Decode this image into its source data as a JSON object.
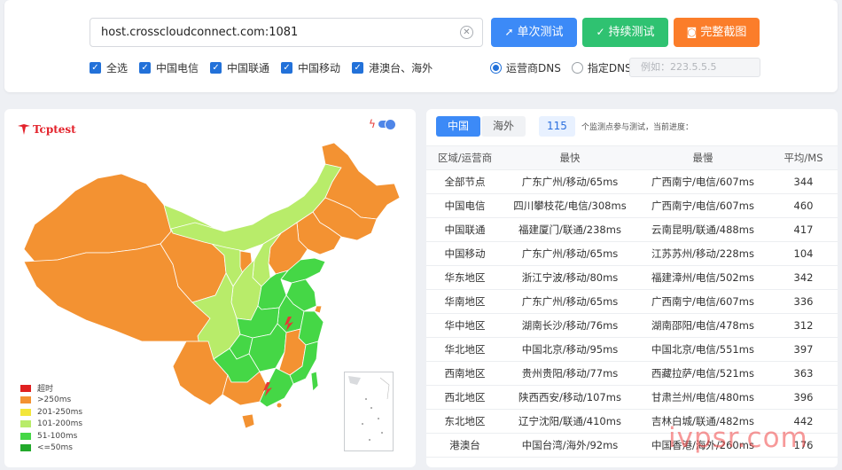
{
  "search": {
    "host_value": "host.crosscloudconnect.com:1081",
    "clear_icon": "clear-circle-icon"
  },
  "buttons": {
    "single_test": "单次测试",
    "continuous_test": "持续测试",
    "full_screenshot": "完整截图",
    "single_icon": "paper-plane-icon",
    "continuous_icon": "check-icon",
    "screenshot_icon": "camera-icon"
  },
  "isp_filters": [
    {
      "label": "全选",
      "checked": true
    },
    {
      "label": "中国电信",
      "checked": true
    },
    {
      "label": "中国联通",
      "checked": true
    },
    {
      "label": "中国移动",
      "checked": true
    },
    {
      "label": "港澳台、海外",
      "checked": true
    }
  ],
  "dns": {
    "option_isp": "运营商DNS",
    "option_custom": "指定DNS:",
    "selected": "运营商DNS",
    "custom_placeholder": "例如：223.5.5.5"
  },
  "map": {
    "logo_text": "Tcptest",
    "legend": [
      {
        "label": "超时",
        "color": "#e02020"
      },
      {
        "label": ">250ms",
        "color": "#f39232"
      },
      {
        "label": "201-250ms",
        "color": "#f3e63a"
      },
      {
        "label": "101-200ms",
        "color": "#b8ec6a"
      },
      {
        "label": "51-100ms",
        "color": "#45d746"
      },
      {
        "label": "<=50ms",
        "color": "#22a92b"
      }
    ]
  },
  "results": {
    "tab_china": "中国",
    "tab_overseas": "海外",
    "node_count": "115",
    "note": "个监测点参与测试，当前进度：",
    "headers": [
      "区域/运营商",
      "最快",
      "最慢",
      "平均/MS"
    ],
    "rows": [
      [
        "全部节点",
        "广东广州/移动/65ms",
        "广西南宁/电信/607ms",
        "344"
      ],
      [
        "中国电信",
        "四川攀枝花/电信/308ms",
        "广西南宁/电信/607ms",
        "460"
      ],
      [
        "中国联通",
        "福建厦门/联通/238ms",
        "云南昆明/联通/488ms",
        "417"
      ],
      [
        "中国移动",
        "广东广州/移动/65ms",
        "江苏苏州/移动/228ms",
        "104"
      ],
      [
        "华东地区",
        "浙江宁波/移动/80ms",
        "福建漳州/电信/502ms",
        "342"
      ],
      [
        "华南地区",
        "广东广州/移动/65ms",
        "广西南宁/电信/607ms",
        "336"
      ],
      [
        "华中地区",
        "湖南长沙/移动/76ms",
        "湖南邵阳/电信/478ms",
        "312"
      ],
      [
        "华北地区",
        "中国北京/移动/95ms",
        "中国北京/电信/551ms",
        "397"
      ],
      [
        "西南地区",
        "贵州贵阳/移动/77ms",
        "西藏拉萨/电信/521ms",
        "363"
      ],
      [
        "西北地区",
        "陕西西安/移动/107ms",
        "甘肃兰州/电信/480ms",
        "396"
      ],
      [
        "东北地区",
        "辽宁沈阳/联通/410ms",
        "吉林白城/联通/482ms",
        "442"
      ],
      [
        "港澳台",
        "中国台湾/海外/92ms",
        "中国香港/海外/260ms",
        "176"
      ]
    ]
  },
  "watermark": "ivpsr.com"
}
